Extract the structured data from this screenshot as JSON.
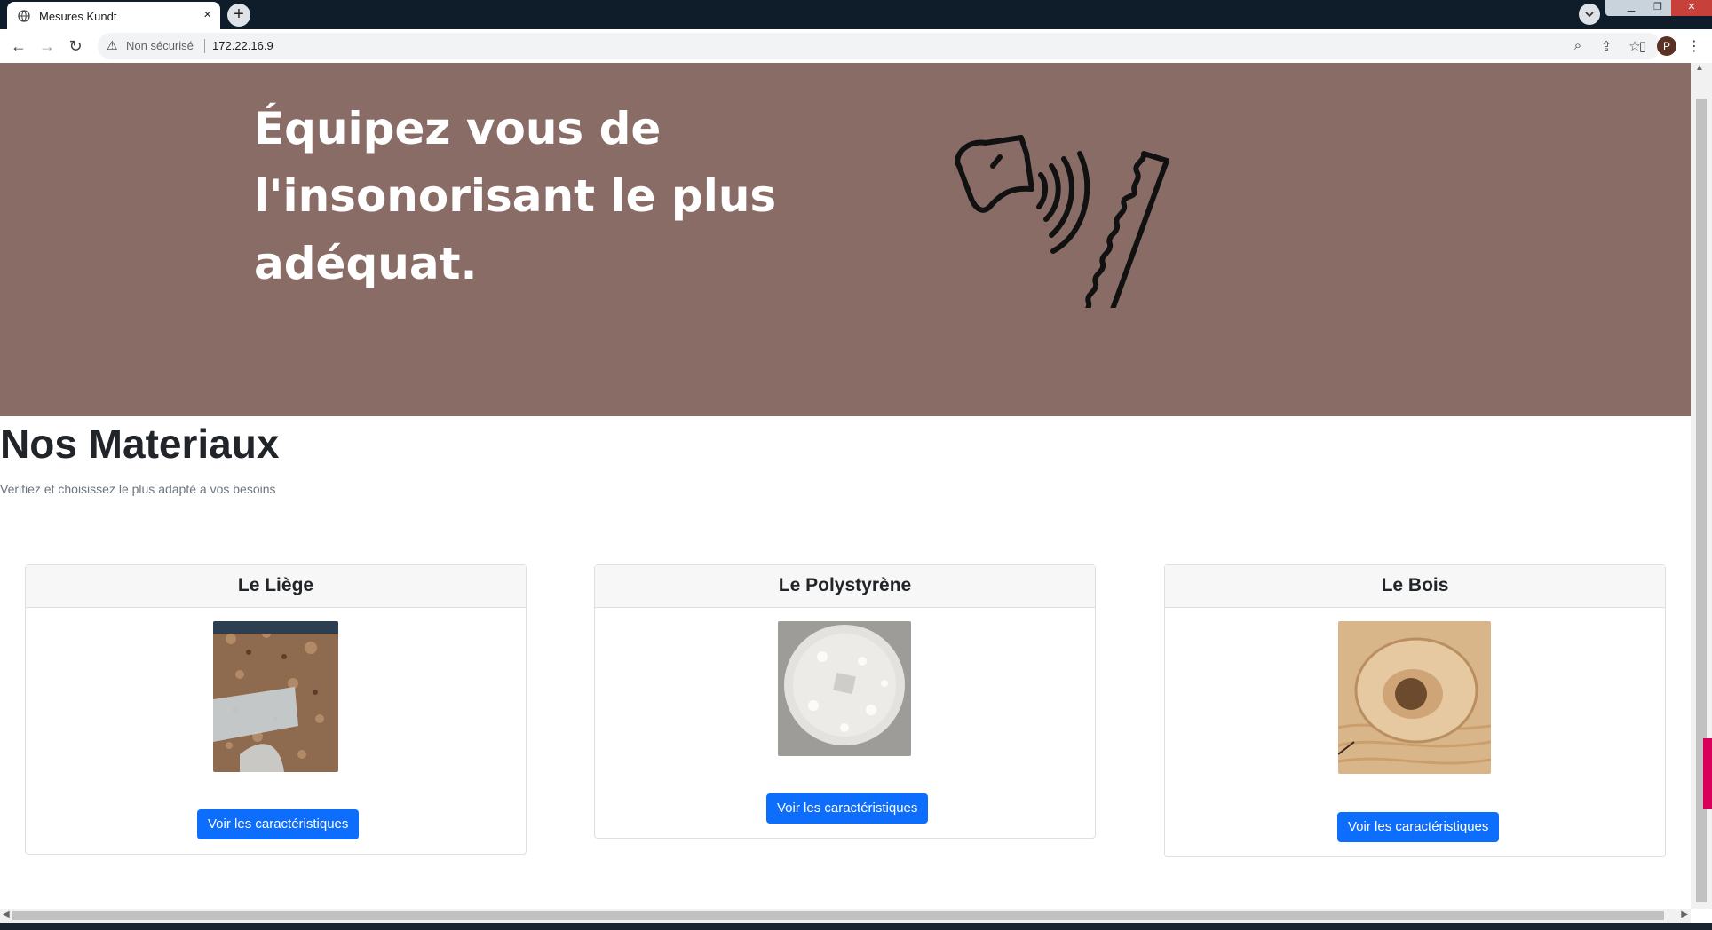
{
  "browser": {
    "tab_title": "Mesures Kundt",
    "tab_close": "×",
    "new_tab": "+",
    "security_label": "Non sécurisé",
    "url": "172.22.16.9",
    "profile_initial": "P"
  },
  "hero": {
    "title": "Équipez vous de l'insonorisant le plus adéquat."
  },
  "section": {
    "title": "Nos Materiaux",
    "subtitle": "Verifiez et choisissez le plus adapté a vos besoins"
  },
  "cards": [
    {
      "title": "Le Liège",
      "button": "Voir les caractéristiques"
    },
    {
      "title": "Le Polystyrène",
      "button": "Voir les caractéristiques"
    },
    {
      "title": "Le Bois",
      "button": "Voir les caractéristiques"
    }
  ],
  "colors": {
    "hero_bg": "#8a6c66",
    "button_bg": "#0d6efd",
    "heading": "#212529",
    "muted": "#6c757d"
  },
  "icons": [
    "globe-icon",
    "close-icon",
    "plus-icon",
    "back-arrow-icon",
    "forward-arrow-icon",
    "reload-icon",
    "warning-icon",
    "zoom-icon",
    "share-icon",
    "star-icon",
    "side-panel-icon",
    "menu-kebab-icon",
    "speaker-sound-wall-icon"
  ]
}
